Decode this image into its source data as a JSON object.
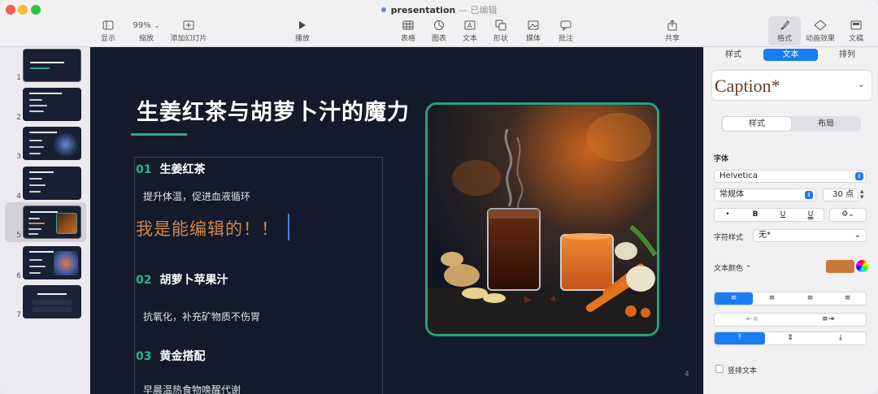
{
  "window": {
    "title": "presentation",
    "title_sep": " — ",
    "status": "已编辑"
  },
  "toolbar": {
    "view_label": "显示",
    "zoom_value": "99%",
    "zoom_label": "缩放",
    "add_slide_label": "添加幻灯片",
    "play_label": "播放",
    "table_label": "表格",
    "chart_label": "图表",
    "text_label": "文本",
    "shape_label": "形状",
    "media_label": "媒体",
    "comment_label": "批注",
    "share_label": "共享",
    "format_label": "格式",
    "animate_label": "动画效果",
    "document_label": "文稿"
  },
  "slides_nav": {
    "numbers": [
      "1",
      "2",
      "3",
      "4",
      "5",
      "6",
      "7"
    ],
    "selected": "5"
  },
  "slide": {
    "title": "生姜红茶与胡萝卜汁的魔力",
    "sections": [
      {
        "num": "01",
        "heading": "生姜红茶",
        "body": "提升体温，促进血液循环"
      },
      {
        "num": "02",
        "heading": "胡萝卜苹果汁",
        "body": "抗氧化，补充矿物质不伤胃"
      },
      {
        "num": "03",
        "heading": "黄金搭配",
        "body": "早晨温热食物唤醒代谢"
      }
    ],
    "edited_text": "我是能编辑的！！",
    "page_number": "4"
  },
  "format_panel": {
    "tabs": [
      "样式",
      "文本",
      "排列"
    ],
    "active_tab": "文本",
    "paragraph_style": "Caption*",
    "subtabs": [
      "样式",
      "布局"
    ],
    "active_subtab": "样式",
    "font_section_label": "字体",
    "font_family": "Helvetica",
    "font_style": "常规体",
    "font_size": "30 点",
    "style_buttons": [
      "•",
      "B",
      "U",
      "U"
    ],
    "char_style_label": "字符样式",
    "char_style_value": "无*",
    "text_color_label": "文本颜色",
    "text_color": "#c87838",
    "vertical_text_label": "竖排文本"
  }
}
